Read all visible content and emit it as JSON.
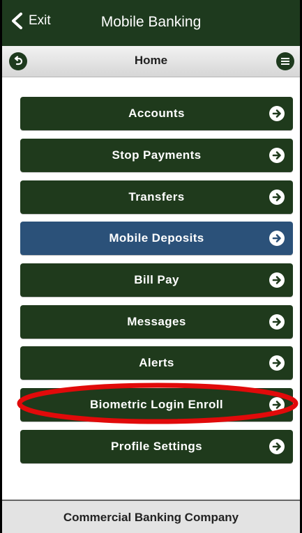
{
  "titlebar": {
    "exit_label": "Exit",
    "title": "Mobile Banking"
  },
  "navbar": {
    "title": "Home"
  },
  "menu": {
    "items": [
      {
        "label": "Accounts"
      },
      {
        "label": "Stop Payments"
      },
      {
        "label": "Transfers"
      },
      {
        "label": "Mobile Deposits",
        "active": true
      },
      {
        "label": "Bill Pay"
      },
      {
        "label": "Messages"
      },
      {
        "label": "Alerts"
      },
      {
        "label": "Biometric Login Enroll",
        "highlighted": true
      },
      {
        "label": "Profile Settings"
      }
    ]
  },
  "footer": {
    "company": "Commercial Banking Company"
  },
  "colors": {
    "brand_green": "#1f3a1c",
    "active_blue": "#2b5179",
    "highlight_red": "#e10a0a",
    "footer_gray": "#e3e3e3"
  },
  "icons": {
    "exit": "chevron-left-icon",
    "back": "undo-arrow-icon",
    "menu": "hamburger-menu-icon",
    "item_arrow": "arrow-right-circle-icon"
  }
}
